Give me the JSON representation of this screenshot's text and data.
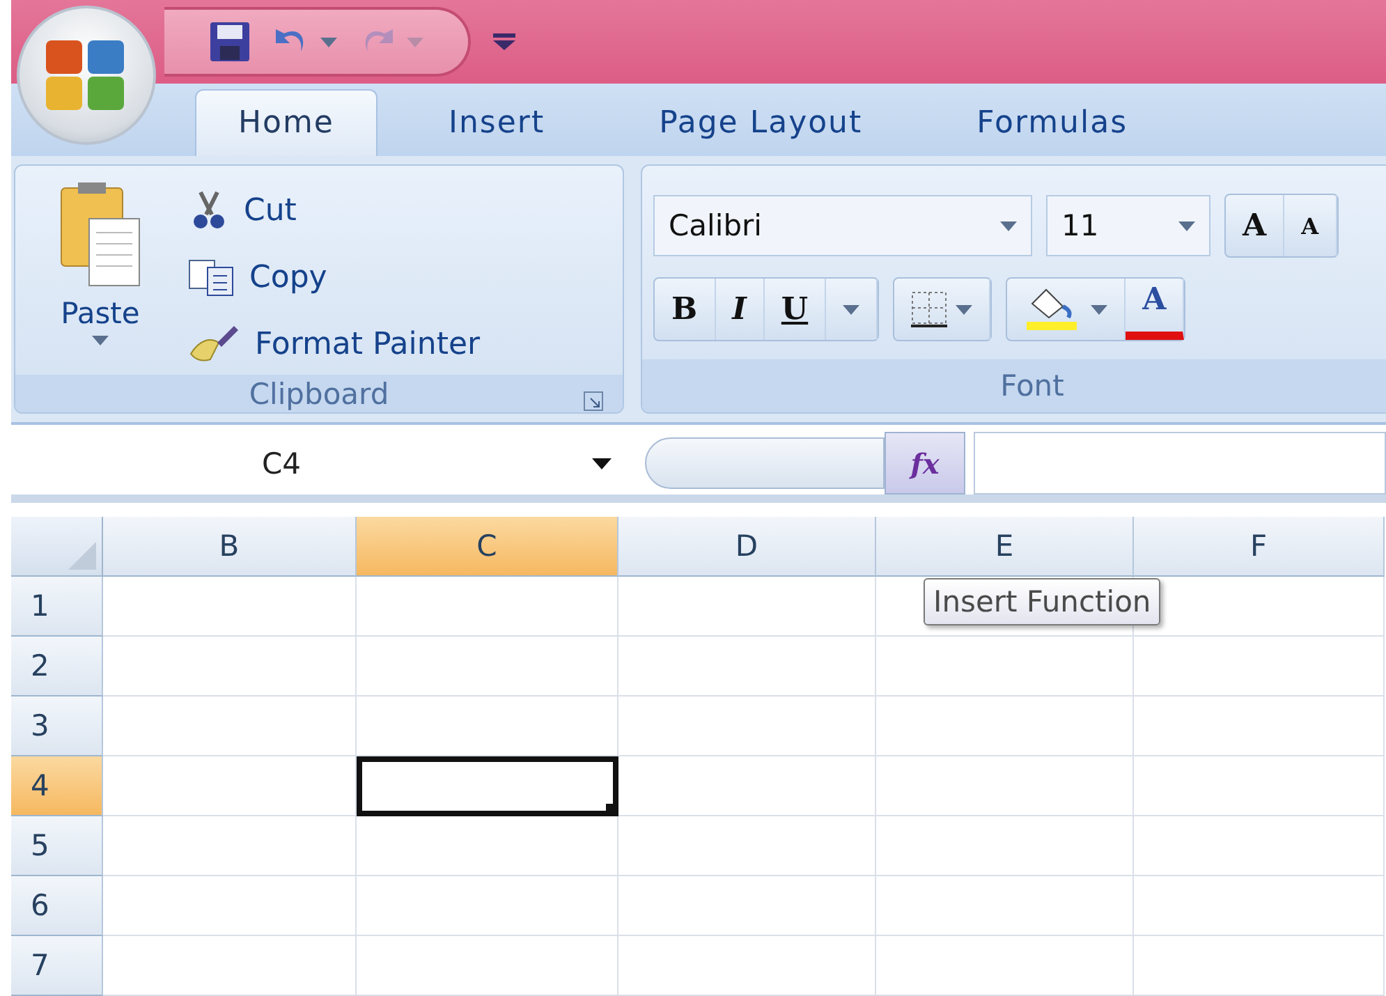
{
  "quick_access": [
    {
      "kind": "save",
      "disabled": false
    },
    {
      "kind": "undo",
      "disabled": false
    },
    {
      "kind": "redo",
      "disabled": true
    },
    {
      "kind": "customize",
      "disabled": false
    }
  ],
  "tabs": [
    {
      "label": "Home",
      "selected": true
    },
    {
      "label": "Insert",
      "selected": false
    },
    {
      "label": "Page Layout",
      "selected": false
    },
    {
      "label": "Formulas",
      "selected": false
    }
  ],
  "clipboard": {
    "title": "Clipboard",
    "paste": "Paste",
    "items": [
      {
        "kind": "cut",
        "label": "Cut"
      },
      {
        "kind": "copy",
        "label": "Copy"
      },
      {
        "kind": "painter",
        "label": "Format Painter"
      }
    ]
  },
  "font": {
    "title": "Font",
    "font_name": "Calibri",
    "font_size": "11",
    "grow": "A",
    "shrink": "A",
    "bold": "B",
    "italic": "I",
    "underline": "U",
    "font_color": "A"
  },
  "formula_bar": {
    "name_box": "C4",
    "function_button": "fx"
  },
  "tooltip": "Insert Function",
  "grid": {
    "columns": [
      {
        "label": "B",
        "selected": false
      },
      {
        "label": "C",
        "selected": true
      },
      {
        "label": "D",
        "selected": false
      },
      {
        "label": "E",
        "selected": false
      },
      {
        "label": "F",
        "selected": false
      }
    ],
    "rows": [
      {
        "label": "1",
        "selected": false
      },
      {
        "label": "2",
        "selected": false
      },
      {
        "label": "3",
        "selected": false
      },
      {
        "label": "4",
        "selected": true
      },
      {
        "label": "5",
        "selected": false
      },
      {
        "label": "6",
        "selected": false
      },
      {
        "label": "7",
        "selected": false
      }
    ]
  }
}
